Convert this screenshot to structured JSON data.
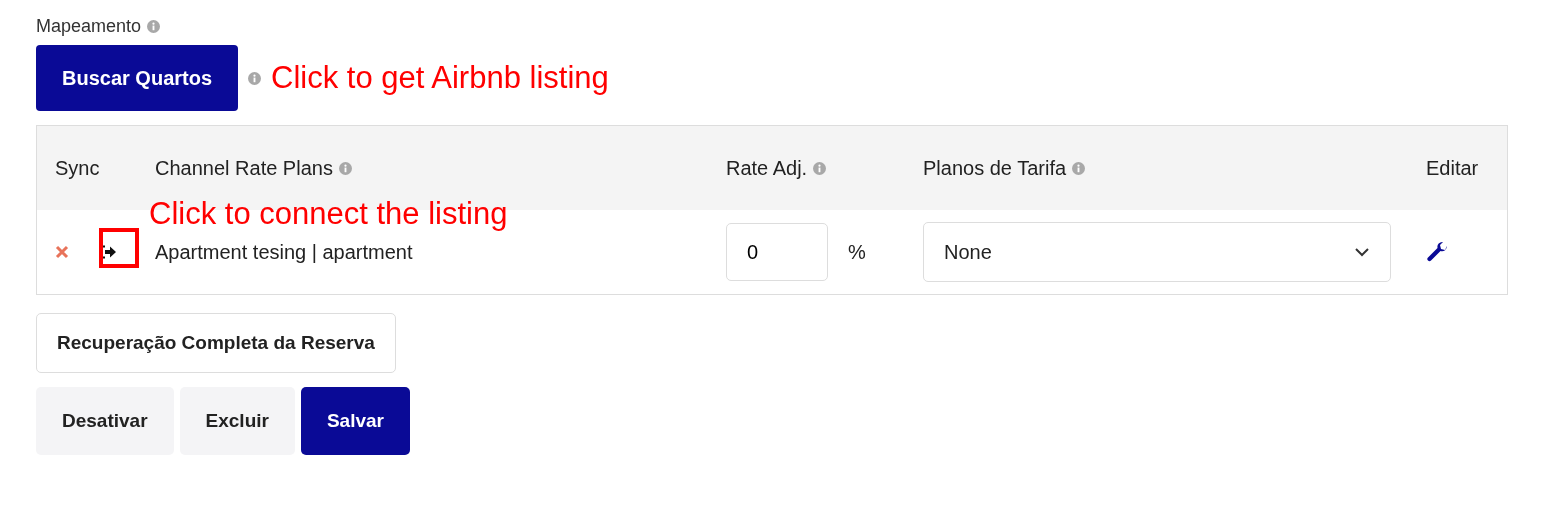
{
  "section_label": "Mapeamento",
  "search_button": "Buscar Quartos",
  "annotations": [
    {
      "text": "Click to get Airbnb listing"
    },
    {
      "text": "Click to connect the listing"
    }
  ],
  "table": {
    "columns": [
      {
        "label": "Sync",
        "info": false
      },
      {
        "label": "Channel Rate Plans",
        "info": true
      },
      {
        "label": "Rate Adj.",
        "info": true
      },
      {
        "label": "Planos de Tarifa",
        "info": true
      },
      {
        "label": "Editar",
        "info": false
      }
    ],
    "rows": [
      {
        "name": "Apartment tesing | apartment",
        "rate_adj": "0",
        "unit": "%",
        "rate_plan": "None",
        "highlighted": true
      }
    ]
  },
  "recovery_button": "Recuperação Completa da Reserva",
  "buttons": [
    {
      "label": "Desativar",
      "kind": "secondary"
    },
    {
      "label": "Excluir",
      "kind": "secondary"
    },
    {
      "label": "Salvar",
      "kind": "primary"
    }
  ]
}
